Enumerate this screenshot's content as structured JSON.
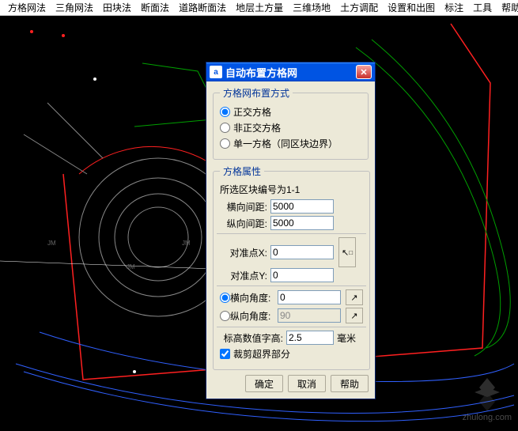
{
  "menu": [
    "方格网法",
    "三角网法",
    "田块法",
    "断面法",
    "道路断面法",
    "地层土方量",
    "三维场地",
    "土方调配",
    "设置和出图",
    "标注",
    "工具",
    "帮助"
  ],
  "dialog": {
    "title": "自动布置方格网",
    "layoutGroup": {
      "legend": "方格网布置方式",
      "options": [
        "正交方格",
        "非正交方格",
        "单一方格（同区块边界）"
      ],
      "selected": 0
    },
    "attrGroup": {
      "legend": "方格属性",
      "note": "所选区块编号为1-1",
      "hspacing_label": "横向间距:",
      "hspacing_value": "5000",
      "vspacing_label": "纵向间距:",
      "vspacing_value": "5000",
      "alignx_label": "对准点X:",
      "alignx_value": "0",
      "aligny_label": "对准点Y:",
      "aligny_value": "0",
      "hangle_label": "横向角度:",
      "hangle_value": "0",
      "vangle_label": "纵向角度:",
      "vangle_value": "90",
      "angle_selected": 0,
      "textheight_label": "标高数值字高:",
      "textheight_value": "2.5",
      "textheight_unit": "毫米",
      "clip_label": "裁剪超界部分",
      "clip_checked": true
    },
    "buttons": {
      "ok": "确定",
      "cancel": "取消",
      "help": "帮助"
    }
  },
  "watermark": "zhulong.com"
}
